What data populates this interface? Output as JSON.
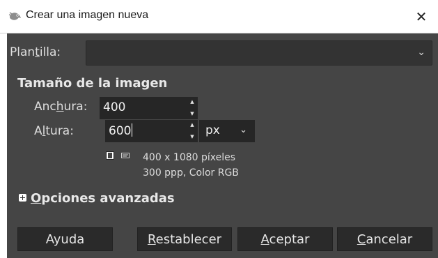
{
  "window": {
    "title": "Crear una imagen nueva",
    "close_symbol": "✕",
    "app_icon": "gimp-wilber-icon"
  },
  "template": {
    "label_pre": "Plan",
    "label_mnemonic": "t",
    "label_post": "illa:",
    "selected": ""
  },
  "image_size": {
    "title": "Tamaño de la imagen",
    "width": {
      "label_pre": "Anc",
      "label_mnemonic": "h",
      "label_post": "ura:",
      "value": "400"
    },
    "height": {
      "label_pre": "A",
      "label_mnemonic": "l",
      "label_post": "tura:",
      "value": "600"
    },
    "unit": "px",
    "info_line1": "400 x 1080 píxeles",
    "info_line2": "300 ppp, Color RGB"
  },
  "advanced": {
    "mnemonic": "O",
    "rest": "pciones avanzadas",
    "icon": "expand-plus-icon"
  },
  "buttons": {
    "help": "Ayuda",
    "reset": {
      "mnemonic": "R",
      "rest": "establecer"
    },
    "ok": {
      "mnemonic": "A",
      "rest": "ceptar"
    },
    "cancel": {
      "mnemonic": "C",
      "rest": "ancelar"
    }
  },
  "colors": {
    "dialog_bg": "#454545",
    "field_bg": "#262626",
    "button_bg": "#2a2a2a"
  }
}
